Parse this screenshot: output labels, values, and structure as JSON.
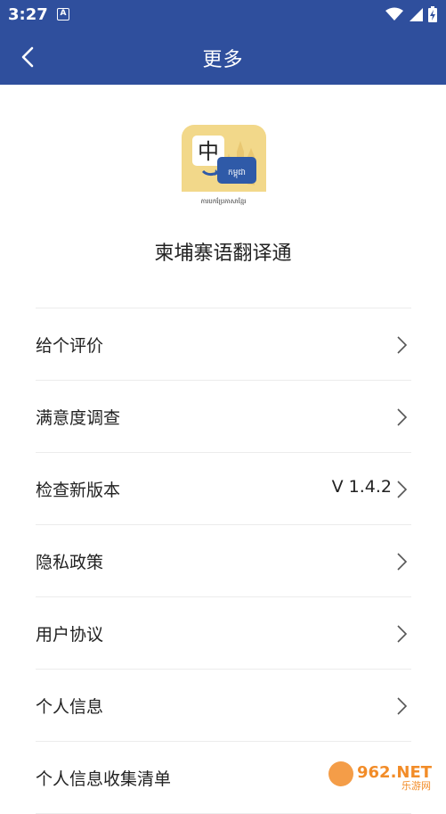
{
  "status_bar": {
    "time": "3:27",
    "notification_icon": "A",
    "icons": [
      "wifi-icon",
      "signal-icon",
      "battery-icon"
    ]
  },
  "app_bar": {
    "title": "更多",
    "back_icon": "chevron-left-icon"
  },
  "app_info": {
    "logo_main_char": "中",
    "logo_khmer_text": "កម្ពុជា",
    "logo_caption": "ការបកប្រែភាសាខ្មែរ",
    "name": "柬埔寨语翻译通"
  },
  "menu": [
    {
      "label": "给个评价",
      "value": ""
    },
    {
      "label": "满意度调查",
      "value": ""
    },
    {
      "label": "检查新版本",
      "value": "V 1.4.2"
    },
    {
      "label": "隐私政策",
      "value": ""
    },
    {
      "label": "用户协议",
      "value": ""
    },
    {
      "label": "个人信息",
      "value": ""
    },
    {
      "label": "个人信息收集清单",
      "value": ""
    }
  ],
  "watermark": {
    "text": "962.NET",
    "subtext": "乐游网"
  },
  "colors": {
    "primary": "#2f4f9d",
    "logo_bg": "#f2d88a",
    "logo_blue": "#2f5aa8"
  }
}
